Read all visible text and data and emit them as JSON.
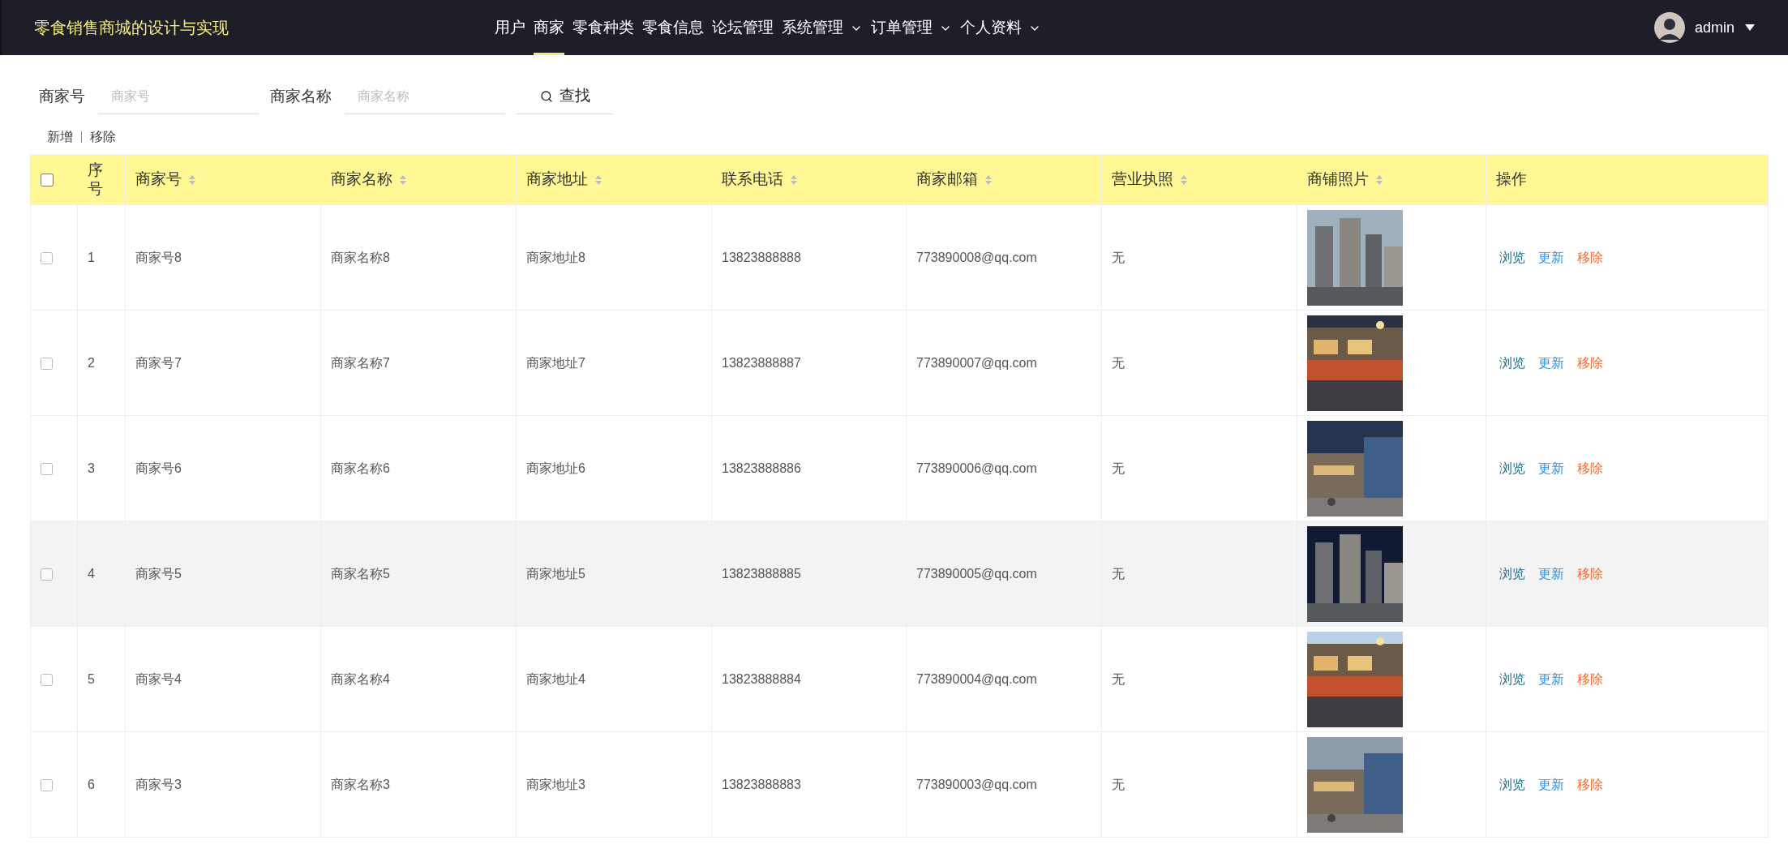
{
  "header": {
    "title": "零食销售商城的设计与实现",
    "user": "admin"
  },
  "nav": [
    {
      "label": "用户",
      "selected": false,
      "dropdown": false
    },
    {
      "label": "商家",
      "selected": true,
      "dropdown": false
    },
    {
      "label": "零食种类",
      "selected": false,
      "dropdown": false
    },
    {
      "label": "零食信息",
      "selected": false,
      "dropdown": false
    },
    {
      "label": "论坛管理",
      "selected": false,
      "dropdown": false
    },
    {
      "label": "系统管理",
      "selected": false,
      "dropdown": true
    },
    {
      "label": "订单管理",
      "selected": false,
      "dropdown": true
    },
    {
      "label": "个人资料",
      "selected": false,
      "dropdown": true
    }
  ],
  "search": {
    "fields": [
      {
        "label": "商家号",
        "placeholder": "商家号"
      },
      {
        "label": "商家名称",
        "placeholder": "商家名称"
      }
    ],
    "button": "查找"
  },
  "actions": [
    "新增",
    "移除"
  ],
  "table": {
    "columns": [
      {
        "label": "序号",
        "sortable": false
      },
      {
        "label": "商家号",
        "sortable": true
      },
      {
        "label": "商家名称",
        "sortable": true
      },
      {
        "label": "商家地址",
        "sortable": true
      },
      {
        "label": "联系电话",
        "sortable": true
      },
      {
        "label": "商家邮箱",
        "sortable": true
      },
      {
        "label": "营业执照",
        "sortable": true
      },
      {
        "label": "商铺照片",
        "sortable": true
      },
      {
        "label": "操作",
        "sortable": false
      }
    ],
    "all_checked": false,
    "rows": [
      {
        "index": "1",
        "id": "商家号8",
        "name": "商家名称8",
        "address": "商家地址8",
        "phone": "13823888888",
        "email": "773890008@qq.com",
        "license": "无",
        "actions": [
          "浏览",
          "更新",
          "移除"
        ],
        "checked": false,
        "hovered": false
      },
      {
        "index": "2",
        "id": "商家号7",
        "name": "商家名称7",
        "address": "商家地址7",
        "phone": "13823888887",
        "email": "773890007@qq.com",
        "license": "无",
        "actions": [
          "浏览",
          "更新",
          "移除"
        ],
        "checked": false,
        "hovered": false
      },
      {
        "index": "3",
        "id": "商家号6",
        "name": "商家名称6",
        "address": "商家地址6",
        "phone": "13823888886",
        "email": "773890006@qq.com",
        "license": "无",
        "actions": [
          "浏览",
          "更新",
          "移除"
        ],
        "checked": false,
        "hovered": false
      },
      {
        "index": "4",
        "id": "商家号5",
        "name": "商家名称5",
        "address": "商家地址5",
        "phone": "13823888885",
        "email": "773890005@qq.com",
        "license": "无",
        "actions": [
          "浏览",
          "更新",
          "移除"
        ],
        "checked": false,
        "hovered": true
      },
      {
        "index": "5",
        "id": "商家号4",
        "name": "商家名称4",
        "address": "商家地址4",
        "phone": "13823888884",
        "email": "773890004@qq.com",
        "license": "无",
        "actions": [
          "浏览",
          "更新",
          "移除"
        ],
        "checked": false,
        "hovered": false
      },
      {
        "index": "6",
        "id": "商家号3",
        "name": "商家名称3",
        "address": "商家地址3",
        "phone": "13823888883",
        "email": "773890003@qq.com",
        "license": "无",
        "actions": [
          "浏览",
          "更新",
          "移除"
        ],
        "checked": false,
        "hovered": false
      }
    ]
  }
}
